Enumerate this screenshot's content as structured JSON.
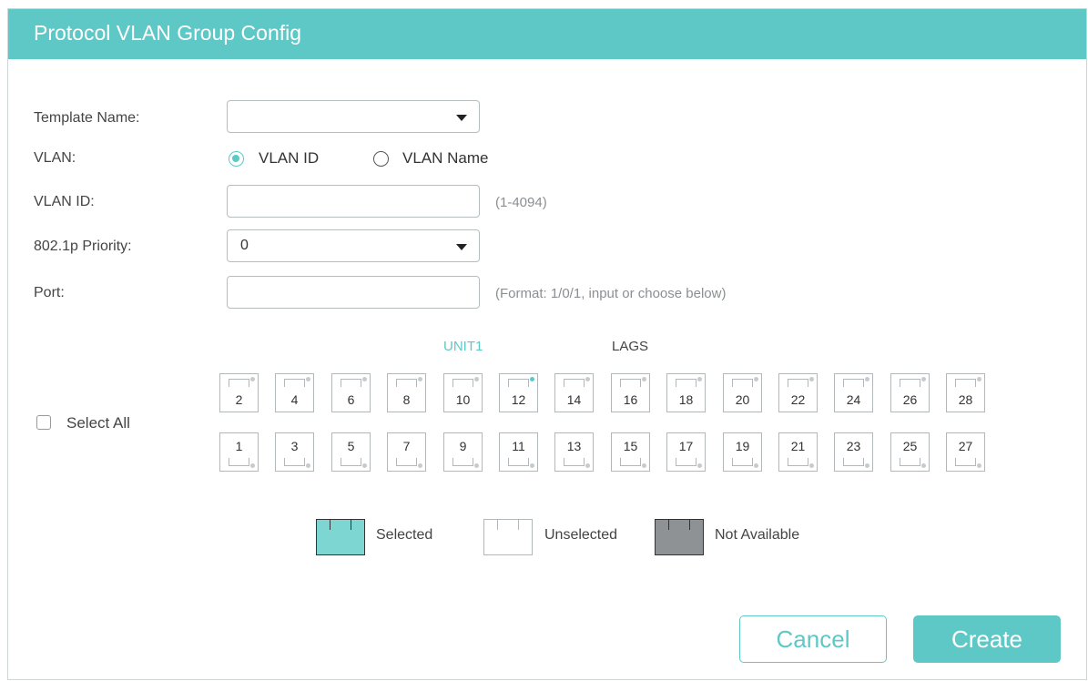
{
  "dialog": {
    "title": "Protocol VLAN Group Config"
  },
  "form": {
    "template_name": {
      "label": "Template Name:",
      "value": ""
    },
    "vlan": {
      "label": "VLAN:",
      "options": [
        "VLAN ID",
        "VLAN Name"
      ],
      "selected": "VLAN ID"
    },
    "vlan_id": {
      "label": "VLAN ID:",
      "value": "",
      "hint": "(1-4094)"
    },
    "priority": {
      "label": "802.1p Priority:",
      "value": "0"
    },
    "port": {
      "label": "Port:",
      "value": "",
      "hint": "(Format: 1/0/1, input or choose below)"
    }
  },
  "port_panel": {
    "tabs": [
      "UNIT1",
      "LAGS"
    ],
    "active_tab": "UNIT1",
    "select_all_label": "Select All",
    "top_row": [
      "2",
      "4",
      "6",
      "8",
      "10",
      "12",
      "14",
      "16",
      "18",
      "20",
      "22",
      "24",
      "26",
      "28"
    ],
    "bottom_row": [
      "1",
      "3",
      "5",
      "7",
      "9",
      "11",
      "13",
      "15",
      "17",
      "19",
      "21",
      "23",
      "25",
      "27"
    ],
    "link_up_ports": [
      "12"
    ]
  },
  "legend": {
    "selected": "Selected",
    "unselected": "Unselected",
    "not_available": "Not Available"
  },
  "colors": {
    "accent": "#5ec8c6",
    "not_available": "#8e9294",
    "border": "#b2b7ba"
  },
  "buttons": {
    "cancel": "Cancel",
    "create": "Create"
  }
}
